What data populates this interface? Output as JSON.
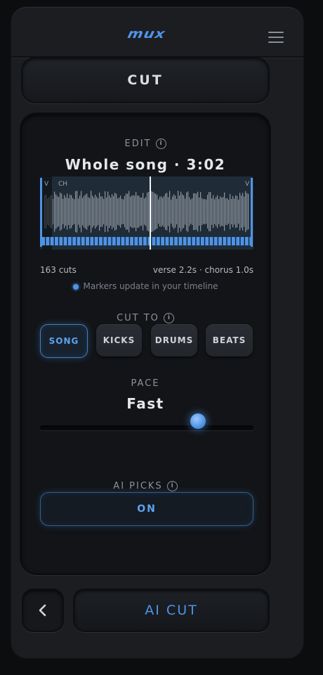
{
  "app": {
    "logo_text": "mux",
    "menu_icon": "hamburger-icon",
    "accent_color": "#4f93e6"
  },
  "mode_button": {
    "label": "CUT"
  },
  "edit": {
    "section_label": "EDIT",
    "info_icon": "info-icon",
    "title": "Whole song · 3:02",
    "waveform": {
      "left_marker_label": "V",
      "left_marker_label_2": "CH",
      "right_marker_label": "V"
    },
    "cuts_count_text": "163 cuts",
    "segments_text": "verse 2.2s · chorus 1.0s",
    "marker_note": "Markers update in your timeline"
  },
  "cut_to": {
    "section_label": "CUT TO",
    "options": [
      "SONG",
      "KICKS",
      "DRUMS",
      "BEATS"
    ],
    "selected": "SONG"
  },
  "pace": {
    "section_label": "PACE",
    "value": "Fast",
    "level": 0.74
  },
  "ai_picks": {
    "section_label": "AI PICKS",
    "toggle_label": "ON"
  },
  "footer": {
    "back_icon": "chevron-left-icon",
    "primary_label": "AI CUT"
  }
}
